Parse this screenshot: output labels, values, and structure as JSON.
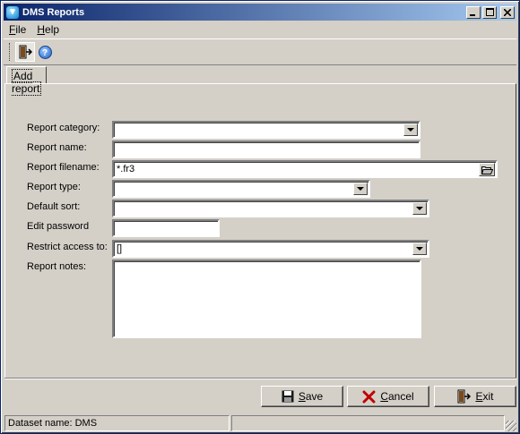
{
  "window": {
    "title": "DMS Reports"
  },
  "menu": [
    {
      "accel": "F",
      "rest": "ile"
    },
    {
      "accel": "H",
      "rest": "elp"
    }
  ],
  "toolbar": {
    "exit_icon": "exit-door-icon",
    "help_icon": "help-icon"
  },
  "tabs": [
    {
      "label": "Add report"
    }
  ],
  "form": {
    "report_category": {
      "label": "Report category:",
      "value": ""
    },
    "report_name": {
      "label": "Report name:",
      "value": ""
    },
    "report_filename": {
      "label": "Report filename:",
      "value": "*.fr3"
    },
    "report_type": {
      "label": "Report type:",
      "value": ""
    },
    "default_sort": {
      "label": "Default sort:",
      "value": ""
    },
    "edit_password": {
      "label": "Edit password",
      "value": ""
    },
    "restrict_access": {
      "label": "Restrict access to:",
      "value": "[]"
    },
    "report_notes": {
      "label": "Report notes:",
      "value": ""
    }
  },
  "buttons": {
    "save": {
      "accel": "S",
      "rest": "ave"
    },
    "cancel": {
      "accel": "C",
      "rest": "ancel"
    },
    "exit": {
      "accel": "E",
      "rest": "xit"
    }
  },
  "status": {
    "dataset": "Dataset name:  DMS",
    "second": ""
  },
  "colors": {
    "title_start": "#0a246a",
    "title_end": "#a6caf0",
    "face": "#d4d0c8",
    "cancel_x": "#c00000"
  }
}
